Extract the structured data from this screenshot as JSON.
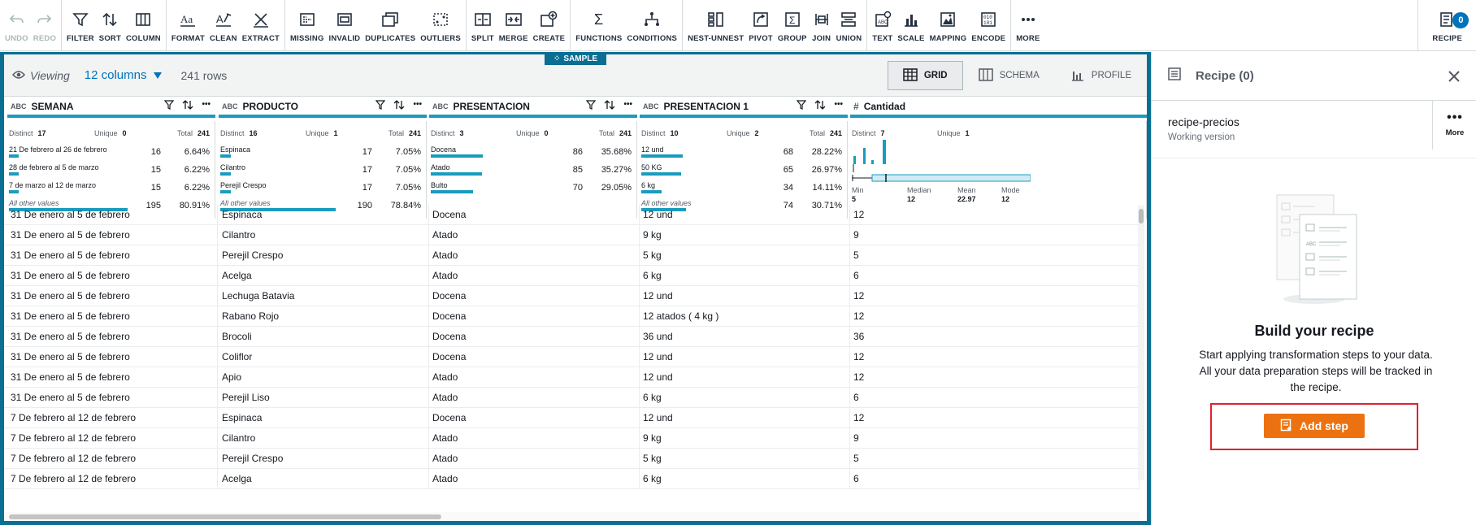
{
  "toolbar": {
    "groups": [
      [
        {
          "label": "UNDO",
          "icon": "undo-icon",
          "disabled": true
        },
        {
          "label": "REDO",
          "icon": "redo-icon",
          "disabled": true
        }
      ],
      [
        {
          "label": "FILTER",
          "icon": "filter-icon"
        },
        {
          "label": "SORT",
          "icon": "sort-icon"
        },
        {
          "label": "COLUMN",
          "icon": "column-icon"
        }
      ],
      [
        {
          "label": "FORMAT",
          "icon": "format-icon"
        },
        {
          "label": "CLEAN",
          "icon": "clean-icon"
        },
        {
          "label": "EXTRACT",
          "icon": "extract-icon"
        }
      ],
      [
        {
          "label": "MISSING",
          "icon": "missing-icon"
        },
        {
          "label": "INVALID",
          "icon": "invalid-icon"
        },
        {
          "label": "DUPLICATES",
          "icon": "duplicates-icon"
        },
        {
          "label": "OUTLIERS",
          "icon": "outliers-icon"
        }
      ],
      [
        {
          "label": "SPLIT",
          "icon": "split-icon"
        },
        {
          "label": "MERGE",
          "icon": "merge-icon"
        },
        {
          "label": "CREATE",
          "icon": "create-icon"
        }
      ],
      [
        {
          "label": "FUNCTIONS",
          "icon": "functions-icon"
        },
        {
          "label": "CONDITIONS",
          "icon": "conditions-icon"
        }
      ],
      [
        {
          "label": "NEST-UNNEST",
          "icon": "nest-unnest-icon"
        },
        {
          "label": "PIVOT",
          "icon": "pivot-icon"
        },
        {
          "label": "GROUP",
          "icon": "group-icon"
        },
        {
          "label": "JOIN",
          "icon": "join-icon"
        },
        {
          "label": "UNION",
          "icon": "union-icon"
        }
      ],
      [
        {
          "label": "TEXT",
          "icon": "text-icon"
        },
        {
          "label": "SCALE",
          "icon": "scale-icon"
        },
        {
          "label": "MAPPING",
          "icon": "mapping-icon"
        },
        {
          "label": "ENCODE",
          "icon": "encode-icon"
        }
      ],
      [
        {
          "label": "MORE",
          "icon": "more-icon"
        }
      ]
    ],
    "recipe": {
      "label": "RECIPE",
      "count": "0"
    }
  },
  "sample_tag": "SAMPLE",
  "viewbar": {
    "viewing": "Viewing",
    "columns": "12 columns",
    "rows": "241 rows"
  },
  "view_tabs": [
    {
      "label": "GRID",
      "active": true
    },
    {
      "label": "SCHEMA",
      "active": false
    },
    {
      "label": "PROFILE",
      "active": false
    }
  ],
  "columns": [
    {
      "type": "ABC",
      "name": "SEMANA",
      "distinct_label": "Distinct",
      "distinct": "17",
      "unique_label": "Unique",
      "unique": "0",
      "total_label": "Total",
      "total": "241",
      "values": [
        {
          "name": "21 De febrero al 26 de febrero",
          "count": "16",
          "pct": "6.64%",
          "frac": 0.0664
        },
        {
          "name": "28 de febrero al 5 de marzo",
          "count": "15",
          "pct": "6.22%",
          "frac": 0.0622
        },
        {
          "name": "7 de marzo al 12 de marzo",
          "count": "15",
          "pct": "6.22%",
          "frac": 0.0622
        },
        {
          "name": "All other values",
          "count": "195",
          "pct": "80.91%",
          "frac": 0.8091,
          "other": true
        }
      ]
    },
    {
      "type": "ABC",
      "name": "PRODUCTO",
      "distinct_label": "Distinct",
      "distinct": "16",
      "unique_label": "Unique",
      "unique": "1",
      "total_label": "Total",
      "total": "241",
      "values": [
        {
          "name": "Espinaca",
          "count": "17",
          "pct": "7.05%",
          "frac": 0.0705
        },
        {
          "name": "Cilantro",
          "count": "17",
          "pct": "7.05%",
          "frac": 0.0705
        },
        {
          "name": "Perejil Crespo",
          "count": "17",
          "pct": "7.05%",
          "frac": 0.0705
        },
        {
          "name": "All other values",
          "count": "190",
          "pct": "78.84%",
          "frac": 0.7884,
          "other": true
        }
      ]
    },
    {
      "type": "ABC",
      "name": "PRESENTACION",
      "distinct_label": "Distinct",
      "distinct": "3",
      "unique_label": "Unique",
      "unique": "0",
      "total_label": "Total",
      "total": "241",
      "values": [
        {
          "name": "Docena",
          "count": "86",
          "pct": "35.68%",
          "frac": 0.3568
        },
        {
          "name": "Atado",
          "count": "85",
          "pct": "35.27%",
          "frac": 0.3527
        },
        {
          "name": "Bulto",
          "count": "70",
          "pct": "29.05%",
          "frac": 0.2905
        }
      ]
    },
    {
      "type": "ABC",
      "name": "PRESENTACION 1",
      "distinct_label": "Distinct",
      "distinct": "10",
      "unique_label": "Unique",
      "unique": "2",
      "total_label": "Total",
      "total": "241",
      "values": [
        {
          "name": "12 und",
          "count": "68",
          "pct": "28.22%",
          "frac": 0.2822
        },
        {
          "name": "50 KG",
          "count": "65",
          "pct": "26.97%",
          "frac": 0.2697
        },
        {
          "name": "6 kg",
          "count": "34",
          "pct": "14.11%",
          "frac": 0.1411
        },
        {
          "name": "All other values",
          "count": "74",
          "pct": "30.71%",
          "frac": 0.3071,
          "other": true
        }
      ]
    },
    {
      "type": "#",
      "name": "Cantidad",
      "distinct_label": "Distinct",
      "distinct": "7",
      "unique_label": "Unique",
      "unique": "1",
      "total_label": "",
      "total": "",
      "numeric": {
        "min_label": "Min",
        "min": "5",
        "median_label": "Median",
        "median": "12",
        "mean_label": "Mean",
        "mean": "22.97",
        "mode_label": "Mode",
        "mode": "12"
      }
    }
  ],
  "rows": [
    [
      "31 De enero al 5 de febrero",
      "Espinaca",
      "Docena",
      "12 und",
      "12"
    ],
    [
      "31 De enero al 5 de febrero",
      "Cilantro",
      "Atado",
      "9 kg",
      "9"
    ],
    [
      "31 De enero al 5 de febrero",
      "Perejil Crespo",
      "Atado",
      "5 kg",
      "5"
    ],
    [
      "31 De enero al 5 de febrero",
      "Acelga",
      "Atado",
      "6 kg",
      "6"
    ],
    [
      "31 De enero al 5 de febrero",
      "Lechuga Batavia",
      "Docena",
      "12 und",
      "12"
    ],
    [
      "31 De enero al 5 de febrero",
      "Rabano Rojo",
      "Docena",
      "12 atados ( 4 kg )",
      "12"
    ],
    [
      "31 De enero al 5 de febrero",
      "Brocoli",
      "Docena",
      "36 und",
      "36"
    ],
    [
      "31 De enero al 5 de febrero",
      "Coliflor",
      "Docena",
      "12 und",
      "12"
    ],
    [
      "31 De enero al 5 de febrero",
      "Apio",
      "Atado",
      "12 und",
      "12"
    ],
    [
      "31 De enero al 5 de febrero",
      "Perejil Liso",
      "Atado",
      "6 kg",
      "6"
    ],
    [
      "7 De febrero al 12 de febrero",
      "Espinaca",
      "Docena",
      "12 und",
      "12"
    ],
    [
      "7 De febrero al 12 de febrero",
      "Cilantro",
      "Atado",
      "9 kg",
      "9"
    ],
    [
      "7 De febrero al 12 de febrero",
      "Perejil Crespo",
      "Atado",
      "5 kg",
      "5"
    ],
    [
      "7 De febrero al 12 de febrero",
      "Acelga",
      "Atado",
      "6 kg",
      "6"
    ]
  ],
  "recipe_panel": {
    "title": "Recipe (0)",
    "name": "recipe-precios",
    "version": "Working version",
    "more": "More",
    "build_title": "Build your recipe",
    "description": "Start applying transformation steps to your data. All your data preparation steps will be tracked in the recipe.",
    "add_step": "Add step"
  },
  "colors": {
    "accent": "#0073bb",
    "frame": "#0a6f93",
    "bar": "#1a9bbf",
    "add_step": "#ec7211",
    "highlight": "#e0212d"
  }
}
